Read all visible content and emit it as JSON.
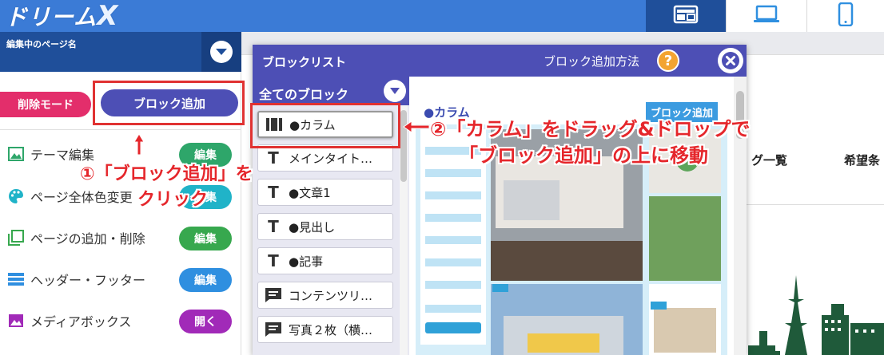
{
  "header": {
    "logo_text": "ドリーム",
    "logo_x": "X",
    "views": [
      {
        "name": "pc-layout",
        "icon": "layout-icon",
        "active": true
      },
      {
        "name": "laptop",
        "icon": "laptop-icon",
        "active": false
      },
      {
        "name": "mobile",
        "icon": "mobile-icon",
        "active": false
      }
    ]
  },
  "page_bar": {
    "label": "編集中のページ名"
  },
  "left_panel": {
    "delete_mode_label": "削除モード",
    "add_block_label": "ブロック追加",
    "menu": [
      {
        "label": "テーマ編集",
        "icon": "image-icon",
        "button": "編集",
        "button_color": "#2ea66a"
      },
      {
        "label": "ページ全体色変更",
        "icon": "palette-icon",
        "button": "編集",
        "button_color": "#20b3c8"
      },
      {
        "label": "ページの追加・削除",
        "icon": "pages-icon",
        "button": "編集",
        "button_color": "#37a84e"
      },
      {
        "label": "ヘッダー・フッター",
        "icon": "header-icon",
        "button": "編集",
        "button_color": "#2f8fe0"
      },
      {
        "label": "メディアボックス",
        "icon": "media-icon",
        "button": "開く",
        "button_color": "#a12ab8"
      }
    ]
  },
  "dialog": {
    "title": "ブロックリスト",
    "how_to_label": "ブロック追加方法",
    "category_label": "全てのブロック",
    "blocks": [
      {
        "label": "●カラム",
        "icon": "column-icon"
      },
      {
        "label": "メインタイト…",
        "icon": "text-icon"
      },
      {
        "label": "●文章1",
        "icon": "text-icon"
      },
      {
        "label": "●見出し",
        "icon": "text-icon"
      },
      {
        "label": "●記事",
        "icon": "text-icon"
      },
      {
        "label": "コンテンツリ…",
        "icon": "comment-icon"
      },
      {
        "label": "写真２枚（横…",
        "icon": "comment-icon"
      }
    ],
    "preview_title": "●カラム",
    "preview_add_label": "ブロック追加"
  },
  "background_page": {
    "nav_items": [
      "グ一覧",
      "希望条"
    ]
  },
  "annotations": {
    "step1_line1": "①「ブロック追加」を",
    "step1_line2": "クリック",
    "step2_line1": "②「カラム」をドラッグ&ドロップで",
    "step2_line2": "「ブロック追加」の上に移動",
    "accent_color": "#e5262b"
  }
}
